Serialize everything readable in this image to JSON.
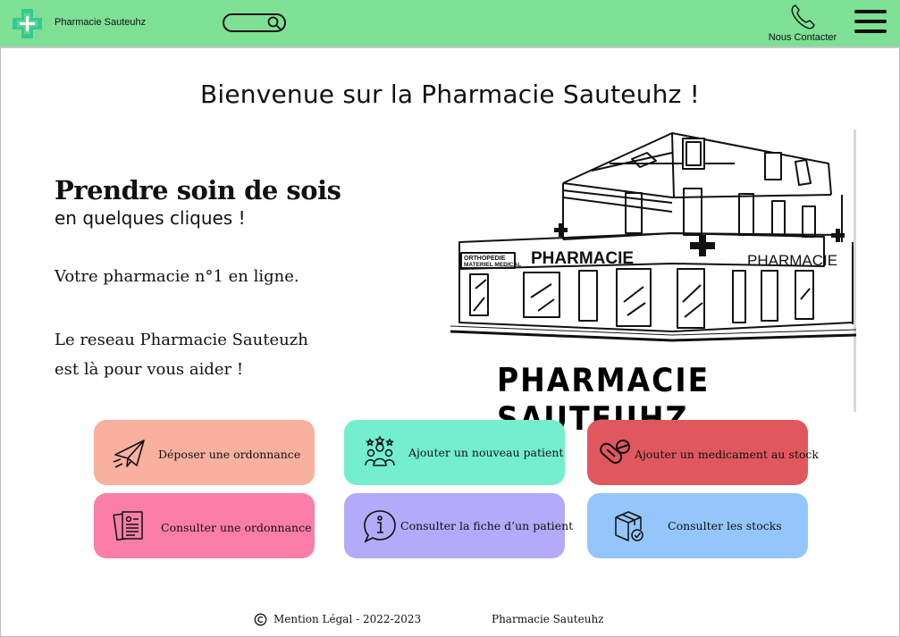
{
  "header": {
    "brand": "Pharmacie Sauteuhz",
    "contact_label": "Nous Contacter",
    "logo_icon": "pharmacy-cross-icon",
    "search_icon": "search-icon",
    "phone_icon": "phone-icon",
    "menu_icon": "hamburger-menu-icon",
    "color": "#7ee094"
  },
  "main": {
    "welcome": "Bienvenue sur la Pharmacie Sauteuhz !",
    "hero_title": "Prendre soin de sois",
    "hero_subtitle": "en quelques cliques !",
    "line1": "Votre pharmacie n°1 en ligne.",
    "line2": "Le reseau Pharmacie Sauteuzh",
    "line3": "est là pour vous aider !",
    "illustration": {
      "sign_left_1": "ORTHOPEDIE",
      "sign_left_2": "MATERIEL MEDICAL",
      "sign_main": "PHARMACIE",
      "sign_right": "PHARMACIE",
      "caption": "PHARMACIE SAUTEUHZ"
    }
  },
  "actions": [
    {
      "label": "Déposer une ordonnance",
      "icon": "paper-plane-icon",
      "color": "#f8b09f"
    },
    {
      "label": "Ajouter un nouveau patient",
      "icon": "people-group-icon",
      "color": "#73efd0"
    },
    {
      "label": "Ajouter un medicament au stock",
      "icon": "pills-icon",
      "color": "#e0585d"
    },
    {
      "label": "Consulter une ordonnance",
      "icon": "prescription-document-icon",
      "color": "#fb7ea8"
    },
    {
      "label": "Consulter la fiche d’un patient",
      "icon": "info-bubble-icon",
      "color": "#b3aafa"
    },
    {
      "label": "Consulter les stocks",
      "icon": "box-check-icon",
      "color": "#94c6fb"
    }
  ],
  "footer": {
    "legal": "Mention Légal - 2022-2023",
    "brand": "Pharmacie Sauteuhz",
    "copyright_icon": "copyright-icon"
  }
}
